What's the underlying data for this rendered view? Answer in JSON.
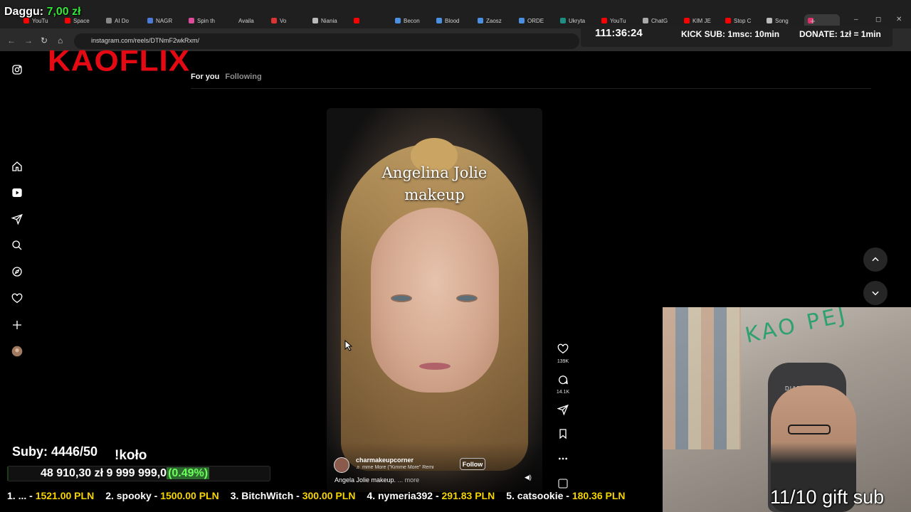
{
  "browser": {
    "tabs": [
      {
        "label": "YouTu",
        "color": "#ff0000"
      },
      {
        "label": "Space",
        "color": "#ff0000"
      },
      {
        "label": "AI Do",
        "color": "#888888"
      },
      {
        "label": "NAGR",
        "color": "#4a7bd8"
      },
      {
        "label": "Spin th",
        "color": "#e04a9a"
      },
      {
        "label": "Availa",
        "color": "#1f1f1f"
      },
      {
        "label": "Vo",
        "color": "#d33"
      },
      {
        "label": "Niania",
        "color": "#bbbbbb"
      },
      {
        "label": "",
        "color": "#ff0000"
      },
      {
        "label": "Becon",
        "color": "#4a90e2"
      },
      {
        "label": "Blood",
        "color": "#4a90e2"
      },
      {
        "label": "Zaosz",
        "color": "#4a90e2"
      },
      {
        "label": "ORDE",
        "color": "#4a90e2"
      },
      {
        "label": "Ukryta",
        "color": "#1b8f84"
      },
      {
        "label": "YouTu",
        "color": "#ff0000"
      },
      {
        "label": "ChatG",
        "color": "#aaaaaa"
      },
      {
        "label": "KIM JE",
        "color": "#ff0000"
      },
      {
        "label": "Stop C",
        "color": "#ff0000"
      },
      {
        "label": "Song",
        "color": "#bbbbbb"
      },
      {
        "label": "",
        "color": "#e1306c"
      }
    ],
    "url": "instagram.com/reels/DTNmF2wkRxm/"
  },
  "overlay": {
    "donor_label": "Daggu:",
    "donor_amount": "7,00 zł",
    "timer": "111:36:24",
    "kick_sub": "KICK SUB: 1msc: 10min",
    "donate": "DONATE: 1zł = 1min",
    "brand": "KAOFLIX",
    "subs": "Suby: 4446/50",
    "wheel": "!koło",
    "goal_current": "48 910,30 zł",
    "goal_target": "9 999 999,0",
    "goal_percent": "(0.49%)",
    "goal_fraction": 0.0049,
    "gift_sub": "11/10 gift sub",
    "leaderboard": [
      {
        "name": "1. ... -",
        "amount": "1521.00 PLN"
      },
      {
        "name": "2. spooky -",
        "amount": "1500.00 PLN"
      },
      {
        "name": "3. BitchWitch -",
        "amount": "300.00 PLN"
      },
      {
        "name": "4. nymeria392 -",
        "amount": "291.83 PLN"
      },
      {
        "name": "5. catsookie -",
        "amount": "180.36 PLN"
      }
    ]
  },
  "instagram": {
    "tab_for_you": "For you",
    "tab_following": "Following",
    "reel": {
      "title_line1": "Angelina Jolie",
      "title_line2": "makeup",
      "username": "charmakeupcorner",
      "audio": "♬ mme More (\"Kimme More\" Remi",
      "follow_label": "Follow",
      "caption": "Angela Jolie makeup.",
      "caption_more": "... more",
      "likes": "139K",
      "comments": "14.1K"
    }
  },
  "webcam": {
    "wall_text": "KAO PEJ",
    "chair_text": "DIABLO"
  }
}
